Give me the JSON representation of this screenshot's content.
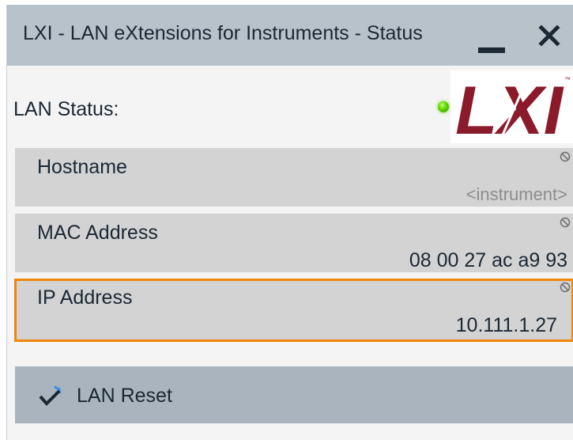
{
  "window": {
    "title": "LXI - LAN eXtensions for Instruments - Status",
    "minimize_icon": "minimize-icon",
    "close_icon": "close-icon"
  },
  "lan_status": {
    "label": "LAN Status:",
    "indicator_state": "connected",
    "indicator_color": "#5fd400",
    "logo_text": "LXI",
    "logo_color": "#8b1a2b"
  },
  "fields": [
    {
      "label": "Hostname",
      "value": "<instrument>",
      "value_is_placeholder": true,
      "readonly_icon": "readonly-icon"
    },
    {
      "label": "MAC Address",
      "value": "08 00 27 ac a9 93",
      "readonly_icon": "readonly-icon"
    },
    {
      "label": "IP Address",
      "value": "10.111.1.27",
      "readonly_icon": "readonly-icon",
      "focused": true
    }
  ],
  "actions": {
    "reset_label": "LAN Reset",
    "reset_icon": "lan-reset-icon"
  },
  "colors": {
    "titlebar": "#b7c2cb",
    "field_background": "#d3d3d3",
    "focus_border": "#f0860a",
    "button_background": "#a9b4be"
  }
}
